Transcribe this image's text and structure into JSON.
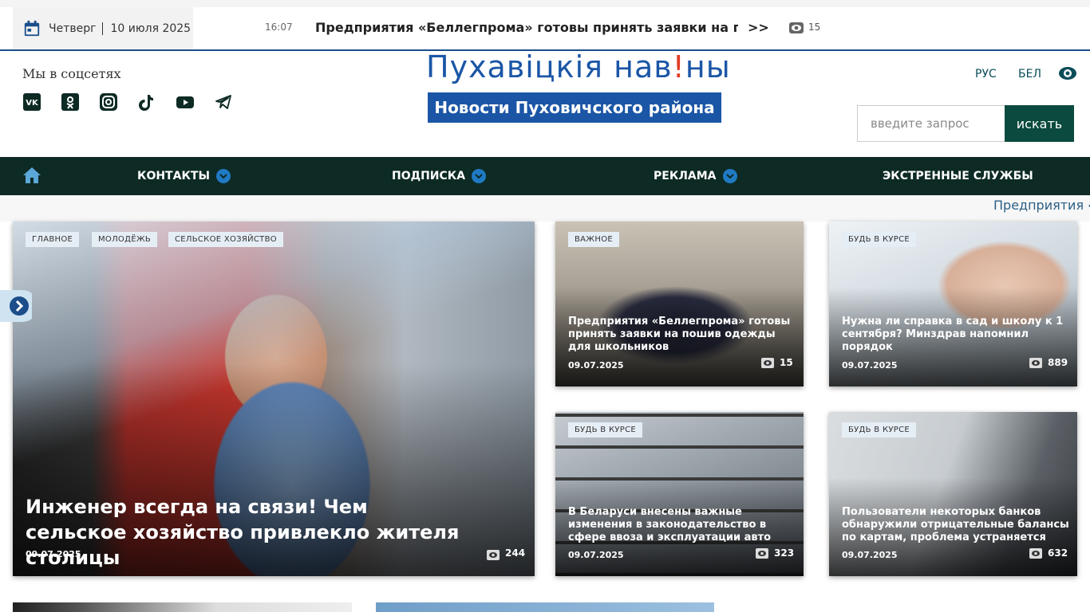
{
  "topbar": {
    "day": "Четверг",
    "date": "10 июля 2025",
    "ticker_time": "16:07",
    "ticker_title": "Предприятия «Беллегпрома» готовы принять заявки на по...",
    "ticker_more": ">>",
    "ticker_views": "15"
  },
  "header": {
    "social_title": "Мы в соцсетях",
    "socials": [
      "vk-icon",
      "odnoklassniki-icon",
      "instagram-icon",
      "tiktok-icon",
      "youtube-icon",
      "telegram-icon"
    ],
    "logo_part1": "Пухавіцкія нав",
    "logo_bang": "!",
    "logo_part2": "ны",
    "logo_sub": "Новости Пуховичского района",
    "lang_ru": "РУС",
    "lang_be": "БЕЛ",
    "search_placeholder": "введите запрос",
    "search_button": "искать"
  },
  "nav": {
    "items": [
      "КОНТАКТЫ",
      "ПОДПИСКА",
      "РЕКЛАМА",
      "ЭКСТРЕННЫЕ СЛУЖБЫ"
    ]
  },
  "strip": {
    "text": "Предприятия «Б"
  },
  "main_card": {
    "tags": [
      "ГЛАВНОЕ",
      "МОЛОДЁЖЬ",
      "СЕЛЬСКОЕ ХОЗЯЙСТВО"
    ],
    "title": "Инженер всегда на связи! Чем сельское хозяйство привлекло жителя столицы",
    "date": "09.07.2025",
    "views": "244"
  },
  "cards": [
    {
      "tag": "ВАЖНОЕ",
      "title": "Предприятия «Беллегпрома» готовы принять заявки на пошив одежды для школьников",
      "date": "09.07.2025",
      "views": "15"
    },
    {
      "tag": "БУДЬ В КУРСЕ",
      "title": "Нужна ли справка в сад и школу к 1 сентября? Минздрав напомнил порядок",
      "date": "09.07.2025",
      "views": "889"
    },
    {
      "tag": "БУДЬ В КУРСЕ",
      "title": "В Беларуси внесены важные изменения в законодательство в сфере ввоза и эксплуатации авто",
      "date": "09.07.2025",
      "views": "323"
    },
    {
      "tag": "БУДЬ В КУРСЕ",
      "title": "Пользователи некоторых банков обнаружили отрицательные балансы по картам, проблема устраняется",
      "date": "09.07.2025",
      "views": "632"
    }
  ],
  "colors": {
    "brand_blue": "#1b56a6",
    "nav_dark": "#0d2a24",
    "search_green": "#0b4a3e",
    "accent_red": "#e23b24"
  }
}
